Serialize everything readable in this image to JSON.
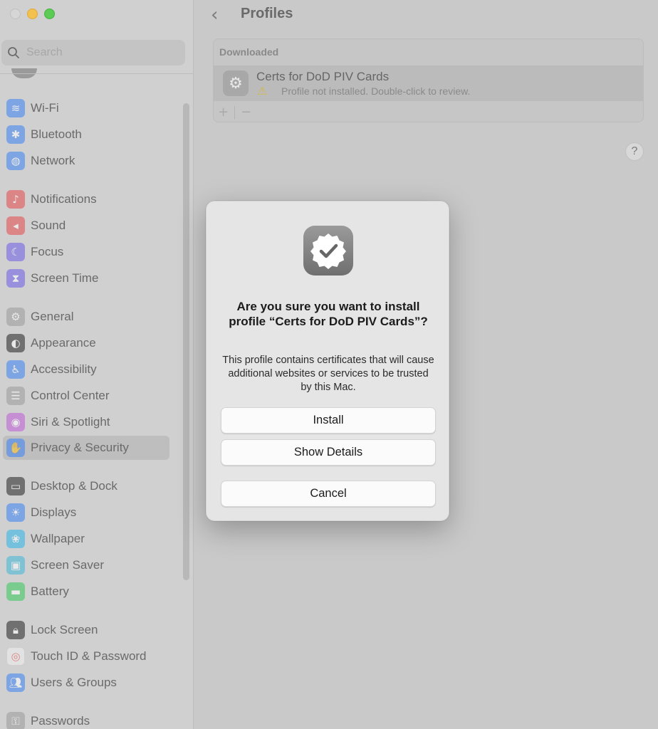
{
  "sidebar": {
    "search_placeholder": "Search",
    "items": [
      {
        "label": "Wi-Fi",
        "icon": "wifi-icon",
        "color": "#3b82f6",
        "glyph": "≋"
      },
      {
        "label": "Bluetooth",
        "icon": "bluetooth-icon",
        "color": "#3b82f6",
        "glyph": "✱"
      },
      {
        "label": "Network",
        "icon": "globe-icon",
        "color": "#3b82f6",
        "glyph": "◍"
      },
      {
        "label": "Notifications",
        "icon": "bell-icon",
        "color": "#e5484d",
        "glyph": "♪"
      },
      {
        "label": "Sound",
        "icon": "speaker-icon",
        "color": "#e5484d",
        "glyph": "◂"
      },
      {
        "label": "Focus",
        "icon": "moon-icon",
        "color": "#6c5ce7",
        "glyph": "☾"
      },
      {
        "label": "Screen Time",
        "icon": "hourglass-icon",
        "color": "#6c5ce7",
        "glyph": "⧗"
      },
      {
        "label": "General",
        "icon": "gear-icon",
        "color": "#9a9a9a",
        "glyph": "⚙"
      },
      {
        "label": "Appearance",
        "icon": "appearance-icon",
        "color": "#222222",
        "glyph": "◐"
      },
      {
        "label": "Accessibility",
        "icon": "accessibility-icon",
        "color": "#3b82f6",
        "glyph": "♿"
      },
      {
        "label": "Control Center",
        "icon": "toggles-icon",
        "color": "#9a9a9a",
        "glyph": "☰"
      },
      {
        "label": "Siri & Spotlight",
        "icon": "siri-icon",
        "color": "#c05bd6",
        "glyph": "◉"
      },
      {
        "label": "Privacy & Security",
        "icon": "hand-icon",
        "color": "#3b82f6",
        "glyph": "✋"
      },
      {
        "label": "Desktop & Dock",
        "icon": "dock-icon",
        "color": "#222222",
        "glyph": "▭"
      },
      {
        "label": "Displays",
        "icon": "sun-icon",
        "color": "#3b82f6",
        "glyph": "☀"
      },
      {
        "label": "Wallpaper",
        "icon": "flower-icon",
        "color": "#2bb3e8",
        "glyph": "❀"
      },
      {
        "label": "Screen Saver",
        "icon": "screensaver-icon",
        "color": "#3fb6d9",
        "glyph": "▣"
      },
      {
        "label": "Battery",
        "icon": "battery-icon",
        "color": "#34c759",
        "glyph": "▬"
      },
      {
        "label": "Lock Screen",
        "icon": "lock-icon",
        "color": "#222222",
        "glyph": "🔒︎"
      },
      {
        "label": "Touch ID & Password",
        "icon": "fingerprint-icon",
        "color": "#f2f2f2",
        "glyph": "◎"
      },
      {
        "label": "Users & Groups",
        "icon": "users-icon",
        "color": "#3b82f6",
        "glyph": "👥︎"
      },
      {
        "label": "Passwords",
        "icon": "key-icon",
        "color": "#9a9a9a",
        "glyph": "⚿"
      }
    ],
    "selected": "Privacy & Security"
  },
  "header": {
    "title": "Profiles"
  },
  "profiles": {
    "section_label": "Downloaded",
    "items": [
      {
        "name": "Certs for DoD PIV Cards",
        "status": "Profile not installed. Double-click to review."
      }
    ],
    "add_label": "+",
    "remove_label": "−"
  },
  "help_label": "?",
  "dialog": {
    "title": "Are you sure you want to install profile “Certs for DoD PIV Cards”?",
    "message": "This profile contains certificates that will cause additional websites or services to be trusted by this Mac.",
    "install_label": "Install",
    "show_details_label": "Show Details",
    "cancel_label": "Cancel"
  }
}
